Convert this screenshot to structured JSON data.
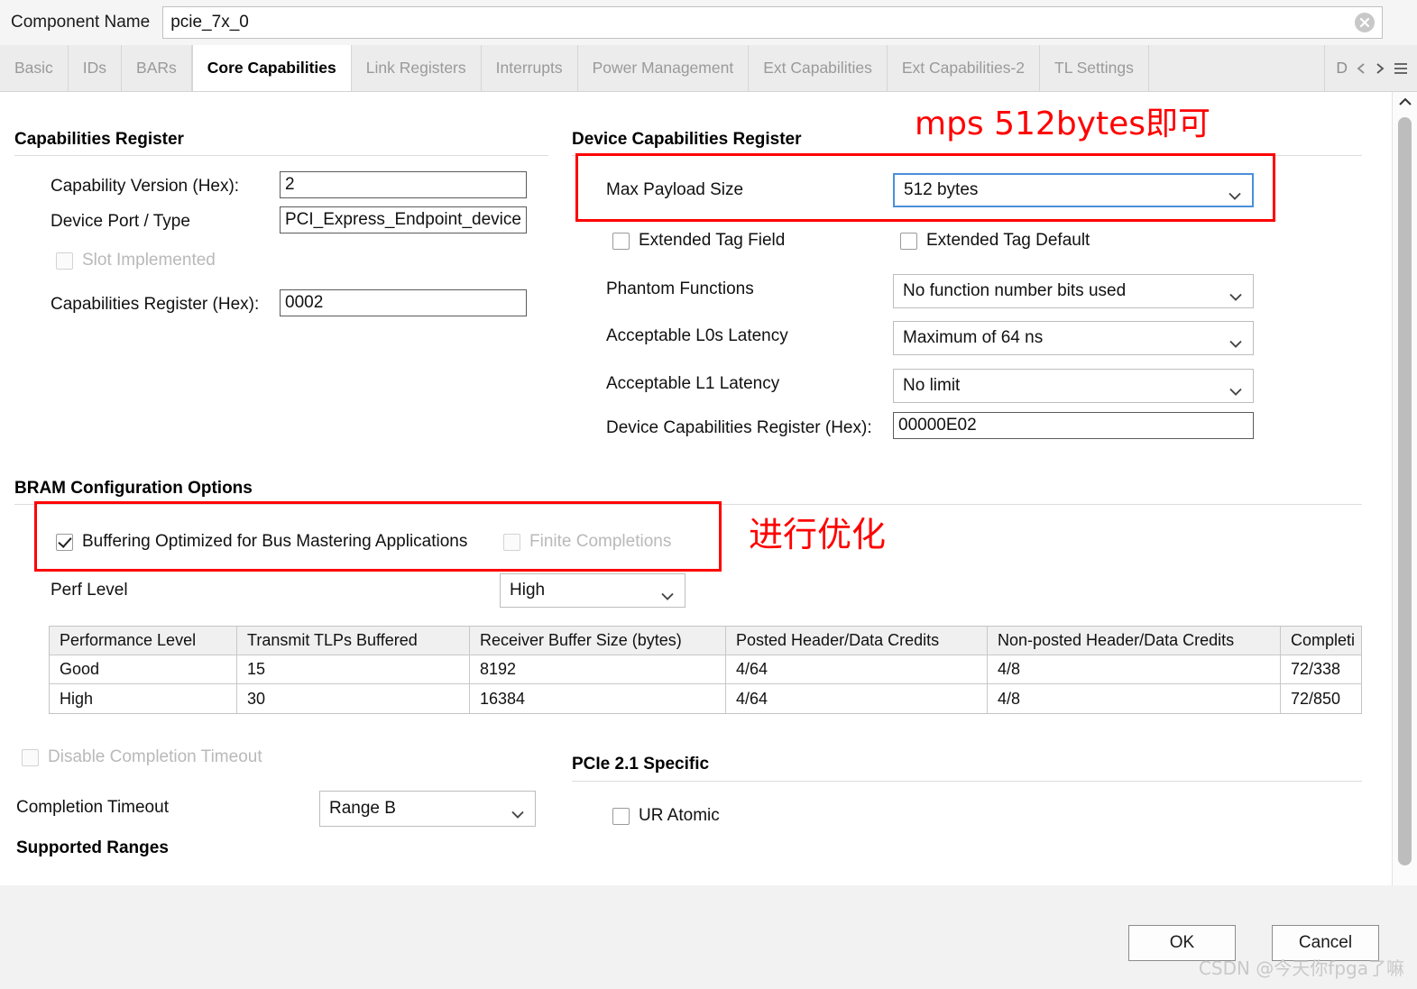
{
  "window": {
    "component_name_label": "Component Name",
    "component_name_value": "pcie_7x_0",
    "clear_icon": "close-circle-icon"
  },
  "tabs": [
    {
      "label": "Basic",
      "active": false
    },
    {
      "label": "IDs",
      "active": false
    },
    {
      "label": "BARs",
      "active": false
    },
    {
      "label": "Core Capabilities",
      "active": true
    },
    {
      "label": "Link Registers",
      "active": false
    },
    {
      "label": "Interrupts",
      "active": false
    },
    {
      "label": "Power Management",
      "active": false
    },
    {
      "label": "Ext Capabilities",
      "active": false
    },
    {
      "label": "Ext Capabilities-2",
      "active": false
    },
    {
      "label": "TL Settings",
      "active": false
    },
    {
      "label": "D",
      "active": false
    }
  ],
  "tab_nav": {
    "prev_icon": "chevron-left-icon",
    "next_icon": "chevron-right-icon",
    "menu_icon": "hamburger-menu-icon"
  },
  "capabilities_register": {
    "title": "Capabilities Register",
    "fields": [
      {
        "label": "Capability Version (Hex):",
        "value": "2"
      },
      {
        "label": "Device Port / Type",
        "value": "PCI_Express_Endpoint_device"
      },
      {
        "label": "Capabilities Register (Hex):",
        "value": "0002"
      }
    ],
    "slot_implemented": {
      "label": "Slot Implemented",
      "checked": false,
      "enabled": false
    }
  },
  "device_capabilities_register": {
    "title": "Device Capabilities Register",
    "max_payload_size": {
      "label": "Max Payload Size",
      "value": "512 bytes"
    },
    "extended_tag_field": {
      "label": "Extended Tag Field",
      "checked": false
    },
    "extended_tag_default": {
      "label": "Extended Tag Default",
      "checked": false
    },
    "phantom_functions": {
      "label": "Phantom Functions",
      "value": "No function number bits used"
    },
    "acceptable_l0s_latency": {
      "label": "Acceptable L0s Latency",
      "value": "Maximum of 64 ns"
    },
    "acceptable_l1_latency": {
      "label": "Acceptable L1 Latency",
      "value": "No limit"
    },
    "hex_field": {
      "label": "Device Capabilities Register (Hex):",
      "value": "00000E02"
    }
  },
  "bram_configuration_options": {
    "title": "BRAM Configuration Options",
    "buffering_optimized": {
      "label": "Buffering Optimized for Bus Mastering Applications",
      "checked": true
    },
    "finite_completions": {
      "label": "Finite Completions",
      "checked": false,
      "enabled": false
    },
    "perf_level": {
      "label": "Perf Level",
      "value": "High"
    }
  },
  "perf_table": {
    "headers": [
      "Performance Level",
      "Transmit TLPs Buffered",
      "Receiver Buffer Size (bytes)",
      "Posted Header/Data Credits",
      "Non-posted Header/Data Credits",
      "Completi"
    ],
    "rows": [
      [
        "Good",
        "15",
        "8192",
        "4/64",
        "4/8",
        "72/338"
      ],
      [
        "High",
        "30",
        "16384",
        "4/64",
        "4/8",
        "72/850"
      ]
    ]
  },
  "completion": {
    "disable_completion_timeout": {
      "label": "Disable Completion Timeout",
      "checked": false,
      "enabled": false
    },
    "completion_timeout": {
      "label": "Completion Timeout",
      "value": "Range B"
    },
    "supported_ranges_title": "Supported Ranges"
  },
  "pcie21_specific": {
    "title": "PCIe 2.1 Specific",
    "ur_atomic": {
      "label": "UR Atomic",
      "checked": false
    }
  },
  "annotations": [
    {
      "text": "mps 512bytes即可",
      "color": "#ff0000"
    },
    {
      "text": "进行优化",
      "color": "#ff0000"
    }
  ],
  "footer": {
    "ok_label": "OK",
    "cancel_label": "Cancel",
    "watermark": "CSDN @今天你fpga了嘛"
  },
  "scrollbars": {
    "vertical_up_icon": "chevron-up-icon",
    "horizontal_left_icon": "chevron-left-icon",
    "horizontal_right_icon": "chevron-right-icon"
  }
}
